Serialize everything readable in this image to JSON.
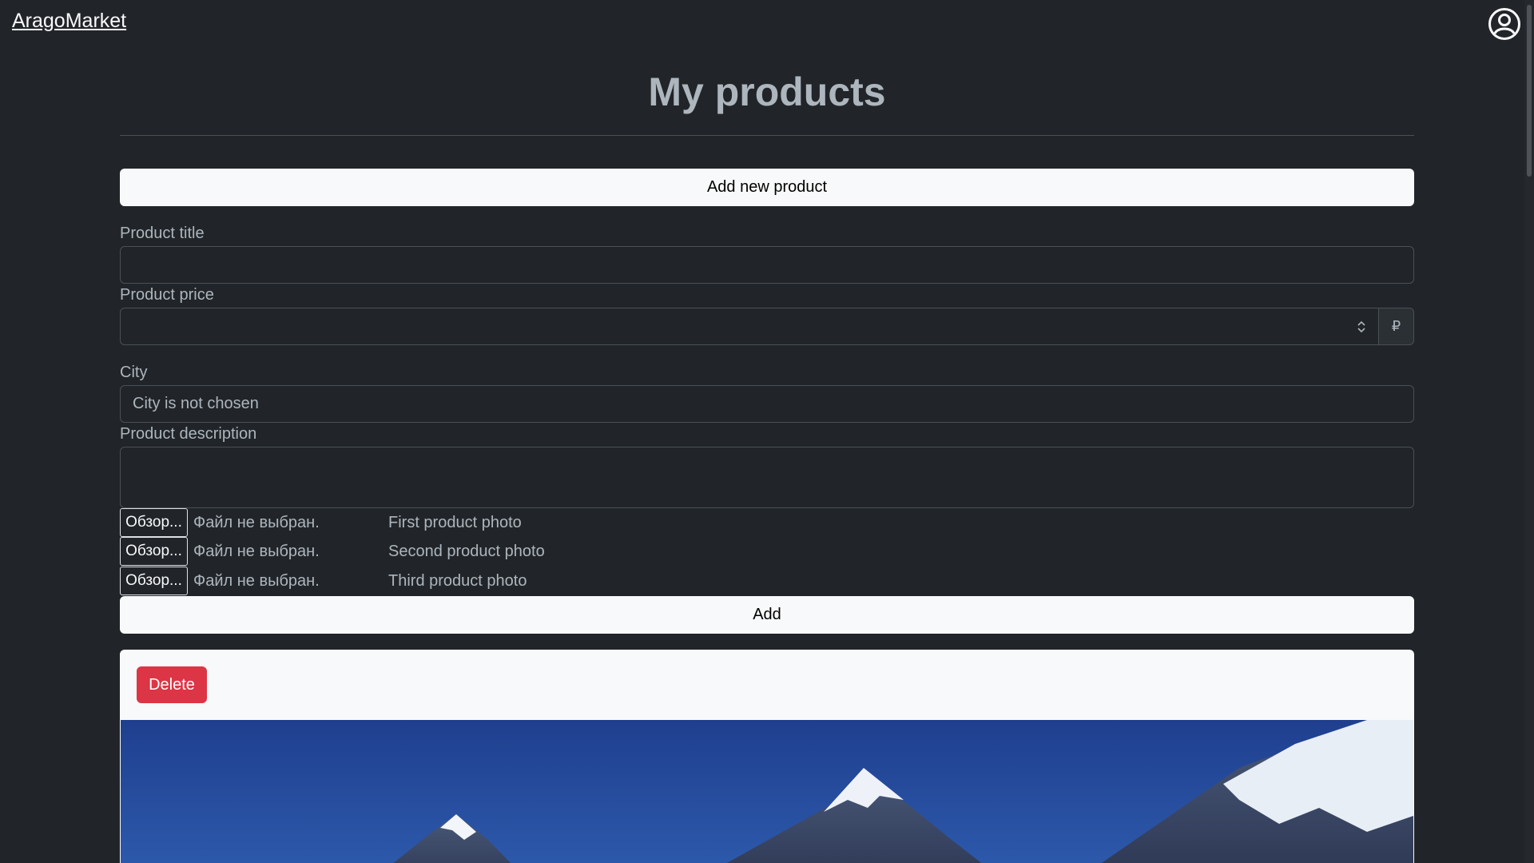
{
  "header": {
    "brand": "AragoMarket",
    "user_icon": "user-circle-icon"
  },
  "main": {
    "title": "My products",
    "add_new_product_label": "Add new product",
    "form": {
      "title_label": "Product title",
      "title_value": "",
      "price_label": "Product price",
      "price_value": "",
      "price_spinner_icon": "spinner-arrows-icon",
      "currency_symbol": "₽",
      "city_label": "City",
      "city_value": "City is not chosen",
      "description_label": "Product description",
      "description_value": "",
      "files": [
        {
          "button": "Обзор...",
          "status": "Файл не выбран.",
          "label": "First product photo"
        },
        {
          "button": "Обзор...",
          "status": "Файл не выбран.",
          "label": "Second product photo"
        },
        {
          "button": "Обзор...",
          "status": "Файл не выбран.",
          "label": "Third product photo"
        }
      ],
      "add_label": "Add"
    },
    "product_card": {
      "delete_label": "Delete",
      "photo": "mountain-landscape-image"
    }
  },
  "colors": {
    "background": "#212529",
    "light_button": "#f8f9fa",
    "danger": "#dc3545",
    "muted_text": "#adb5bd"
  }
}
